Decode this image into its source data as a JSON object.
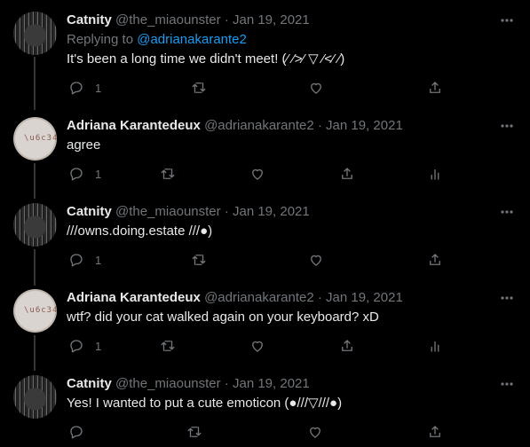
{
  "tweets": [
    {
      "name": "Catnity",
      "handle": "@the_miaounster",
      "date": "Jan 19, 2021",
      "avatar": "cat-avatar",
      "replying_prefix": "Replying to",
      "replying_to": "@adrianakarante2",
      "text": "It's been a long time we didn't meet! (⁄ ⁄>⁄ ▽ ⁄<⁄ ⁄)",
      "reply_count": "1",
      "icons": [
        "reply-icon",
        "retweet-icon",
        "like-icon",
        "share-icon"
      ]
    },
    {
      "name": "Adriana Karantedeux",
      "handle": "@adrianakarante2",
      "date": "Jan 19, 2021",
      "avatar": "adriana-avatar",
      "text": "agree",
      "reply_count": "1",
      "icons": [
        "reply-icon",
        "retweet-icon",
        "like-icon",
        "share-icon",
        "analytics-icon"
      ]
    },
    {
      "name": "Catnity",
      "handle": "@the_miaounster",
      "date": "Jan 19, 2021",
      "avatar": "cat-avatar",
      "text": "///owns.doing.estate ///●)",
      "reply_count": "1",
      "icons": [
        "reply-icon",
        "retweet-icon",
        "like-icon",
        "share-icon"
      ]
    },
    {
      "name": "Adriana Karantedeux",
      "handle": "@adrianakarante2",
      "date": "Jan 19, 2021",
      "avatar": "adriana-avatar",
      "text": "wtf? did your cat walked again on your keyboard? xD",
      "reply_count": "1",
      "icons": [
        "reply-icon",
        "retweet-icon",
        "like-icon",
        "share-icon",
        "analytics-icon"
      ]
    },
    {
      "name": "Catnity",
      "handle": "@the_miaounster",
      "date": "Jan 19, 2021",
      "avatar": "cat-avatar",
      "text": "Yes! I wanted to put a cute emoticon (●///▽///●)",
      "reply_count": "",
      "icons": [
        "reply-icon",
        "retweet-icon",
        "like-icon",
        "share-icon"
      ]
    }
  ],
  "separator": "·",
  "colors": {
    "background": "#000000",
    "text": "#e7e9ea",
    "muted": "#71767b",
    "link": "#1d9bf0",
    "thread_line": "#333639"
  }
}
